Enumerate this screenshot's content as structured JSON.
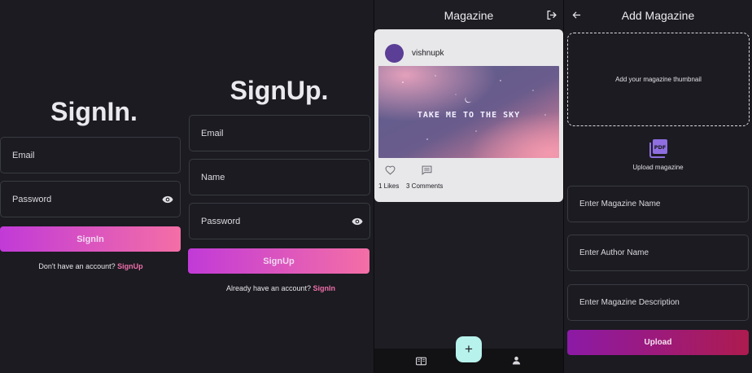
{
  "signin": {
    "title": "SignIn.",
    "email_placeholder": "Email",
    "password_placeholder": "Password",
    "button_label": "SignIn",
    "prompt_text": "Don't have an account?",
    "prompt_link": "SignUp"
  },
  "signup": {
    "title": "SignUp.",
    "email_placeholder": "Email",
    "name_placeholder": "Name",
    "password_placeholder": "Password",
    "button_label": "SignUp",
    "prompt_text": "Already have an account?",
    "prompt_link": "SignIn"
  },
  "feed": {
    "title": "Magazine",
    "post": {
      "username": "vishnupk",
      "thumbnail_text": "TAKE ME TO THE SKY",
      "likes_label": "1 Likes",
      "comments_label": "3 Comments"
    },
    "fab_label": "+",
    "icons": {
      "logout": "logout-icon",
      "like": "heart-icon",
      "comment": "comment-icon",
      "library": "magazine-tab-icon",
      "profile": "profile-tab-icon"
    }
  },
  "add_magazine": {
    "title": "Add Magazine",
    "thumbnail_prompt": "Add your magazine thumbnail",
    "upload_caption": "Upload magazine",
    "name_placeholder": "Enter Magazine Name",
    "author_placeholder": "Enter Author Name",
    "description_placeholder": "Enter Magazine Description",
    "button_label": "Upload"
  },
  "colors": {
    "background": "#1b1b21",
    "gradient_start": "#c13ad8",
    "gradient_end": "#f46ea6",
    "link": "#ee6ea9",
    "fab": "#b8f2ec",
    "upload_start": "#8c1aa6",
    "upload_end": "#ad1b4f"
  }
}
